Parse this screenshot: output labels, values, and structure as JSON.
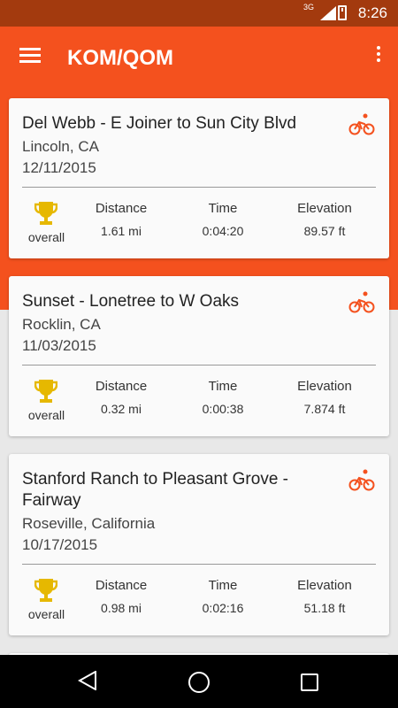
{
  "status": {
    "network": "3G",
    "time": "8:26"
  },
  "appbar": {
    "title": "KOM/QOM"
  },
  "segments": [
    {
      "name": "Del Webb - E Joiner to Sun City Blvd",
      "location": "Lincoln, CA",
      "date": "12/11/2015",
      "rank": "overall",
      "distance_label": "Distance",
      "distance": "1.61 mi",
      "time_label": "Time",
      "time": "0:04:20",
      "elevation_label": "Elevation",
      "elevation": "89.57 ft"
    },
    {
      "name": "Sunset - Lonetree to W Oaks",
      "location": "Rocklin, CA",
      "date": "11/03/2015",
      "rank": "overall",
      "distance_label": "Distance",
      "distance": "0.32 mi",
      "time_label": "Time",
      "time": "0:00:38",
      "elevation_label": "Elevation",
      "elevation": "7.874 ft"
    },
    {
      "name": "Stanford Ranch to Pleasant Grove - Fairway",
      "location": "Roseville, California",
      "date": "10/17/2015",
      "rank": "overall",
      "distance_label": "Distance",
      "distance": "0.98 mi",
      "time_label": "Time",
      "time": "0:02:16",
      "elevation_label": "Elevation",
      "elevation": "51.18 ft"
    }
  ],
  "colors": {
    "accent": "#f4511e",
    "statusbar": "#a33a0e",
    "trophy": "#e6b800"
  }
}
